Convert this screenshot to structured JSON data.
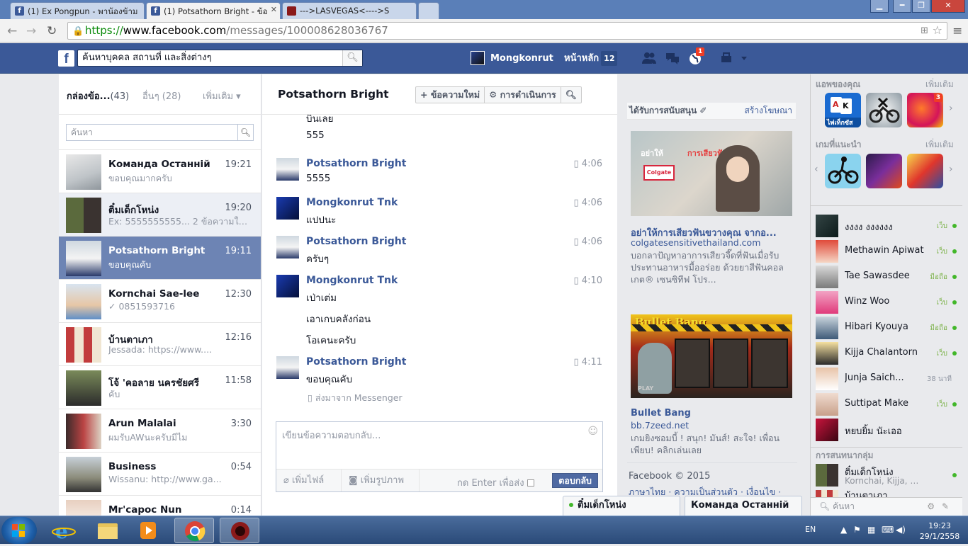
{
  "browser": {
    "tabs": [
      {
        "title": "(1) Ex Pongpun - พาน้องข้าม",
        "favicon": "f",
        "active": false
      },
      {
        "title": "(1) Potsathorn Bright - ข้อ",
        "favicon": "f",
        "active": true
      },
      {
        "title": "--->LASVEGAS<---->S",
        "favicon": "lasvegas-icon",
        "active": false
      }
    ],
    "url_scheme": "https://",
    "url_host": "www.facebook.com",
    "url_path": "/messages/100008628036767"
  },
  "topbar": {
    "logo": "f",
    "search_placeholder": "ค้นหาบุคคล สถานที่ และสิ่งต่างๆ",
    "user_name": "Mongkonrut",
    "home_label": "หน้าหลัก",
    "home_count": "12",
    "notif_count": "1"
  },
  "inbox": {
    "label": "กล่องข้อ...",
    "count": "(43)",
    "other_label": "อื่นๆ (28)",
    "more_label": "เพิ่มเติม ▾",
    "search_placeholder": "ค้นหา",
    "threads": [
      {
        "name": "Команда Останній",
        "time": "19:21",
        "snippet": "ขอบคุณมากครับ",
        "state": "normal"
      },
      {
        "name": "ติ๋มเด็กโหน่ง",
        "time": "19:20",
        "snippet": "Ex: 5555555555...   2 ข้อความใหม่",
        "state": "unread"
      },
      {
        "name": "Potsathorn Bright",
        "time": "19:11",
        "snippet": "ขอบคุณคับ",
        "state": "selected"
      },
      {
        "name": "Kornchai Sae-lee",
        "time": "12:30",
        "snippet": "✓ 0851593716",
        "state": "normal"
      },
      {
        "name": "บ้านตาเภา",
        "time": "12:16",
        "snippet": "Jessada: https://www....",
        "state": "normal"
      },
      {
        "name": "โจ้ 'คอลาย นครชัยศรี",
        "time": "11:58",
        "snippet": "คับ",
        "state": "normal"
      },
      {
        "name": "Arun Malalai",
        "time": "3:30",
        "snippet": "ผมรับAWนะครับมีไม",
        "state": "normal"
      },
      {
        "name": "Business",
        "time": "0:54",
        "snippet": "Wissanu: http://www.ga...",
        "state": "normal"
      },
      {
        "name": "Mr'capoc Nun",
        "time": "0:14",
        "snippet": "",
        "state": "normal"
      }
    ]
  },
  "conversation": {
    "title": "Potsathorn Bright",
    "new_message_label": "+ ข้อความใหม่",
    "actions_label": "⚙ การดำเนินการ",
    "messages": [
      {
        "sender": "",
        "time": "",
        "lines": [
          "บินเลย",
          "555"
        ]
      },
      {
        "sender": "Potsathorn Bright",
        "time": "4:06",
        "lines": [
          "5555"
        ]
      },
      {
        "sender": "Mongkonrut Tnk",
        "time": "4:06",
        "lines": [
          "แปปนะ"
        ]
      },
      {
        "sender": "Potsathorn Bright",
        "time": "4:06",
        "lines": [
          "ครับๆ"
        ]
      },
      {
        "sender": "Mongkonrut Tnk",
        "time": "4:10",
        "lines": [
          "เป่าเต่ม",
          "เอาเกบคลังก่อน",
          "โอเคนะครับ"
        ]
      },
      {
        "sender": "Potsathorn Bright",
        "time": "4:11",
        "lines": [
          "ขอบคุณคับ"
        ]
      }
    ],
    "sent_via": "ส่งมาจาก Messenger",
    "reply_placeholder": "เขียนข้อความตอบกลับ...",
    "attach_label": "เพิ่มไฟล์",
    "photo_label": "เพิ่มรูปภาพ",
    "enter_label": "กด Enter เพื่อส่ง",
    "send_label": "ตอบกลับ"
  },
  "ads": {
    "header": "ได้รับการสนับสนุน",
    "create_label": "สร้างโฆษณา",
    "ad1": {
      "img_text1": "อย่าให้",
      "img_text2": "การเสียวฟัน",
      "img_box": "Colgate",
      "title": "อย่าให้การเสียวฟันขวางคุณ จากอ...",
      "url": "colgatesensitivethailand.com",
      "desc": "บอกลาปัญหาอาการเสียวจี๊ดที่ฟันเมื่อรับประทานอาหารมื้ออร่อย ด้วยยาสีฟันคอลเกต® เซนซิทีฟ โปร..."
    },
    "ad2": {
      "img_logo": "Bullet Bang",
      "img_play": "PLAY",
      "title": "Bullet Bang",
      "url": "bb.7zeed.net",
      "desc": "เกมยิงซอมบี้ ! สนุก! มันส์! สะใจ! เพื่อนเพียบ! คลิกเล่นเลย"
    },
    "footer": "Facebook © 2015",
    "footer_links": "ภาษาไทย · ความเป็นส่วนตัว · เงื่อนไข ·"
  },
  "sidebar": {
    "apps_label": "แอพของคุณ",
    "apps_more": "เพิ่มเติม",
    "app1_label": "ไพ่เท็กซัส",
    "app3_badge": "3",
    "games_label": "เกมที่แนะนำ",
    "games_more": "เพิ่มเติม",
    "friends": [
      {
        "name": "งงงง งงงงงง",
        "status": "เว็บ"
      },
      {
        "name": "Methawin Apiwat",
        "status": "เว็บ"
      },
      {
        "name": "Tae Sawasdee",
        "status": "มือถือ"
      },
      {
        "name": "Winz Woo",
        "status": "เว็บ"
      },
      {
        "name": "Hibari Kyouya",
        "status": "มือถือ"
      },
      {
        "name": "Kijja Chalantorn",
        "status": "เว็บ"
      },
      {
        "name": "Junja Saich...",
        "status": "38 นาที"
      },
      {
        "name": "Suttipat Make",
        "status": "เว็บ"
      },
      {
        "name": "หยบยิ้ม นัะเออ",
        "status": ""
      }
    ],
    "groups_label": "การสนทนากลุ่ม",
    "group1_name": "ติ๋มเด็กโหน่ง",
    "group1_members": "Kornchai, Kijja, Wiss...",
    "group2_name": "บ้านตาเภา",
    "search_placeholder": "ค้นหา"
  },
  "chat_tabs": [
    "ติ๋มเด็กโหน่ง",
    "Команда Останній"
  ],
  "taskbar": {
    "lang": "EN",
    "time": "19:23",
    "date": "29/1/2558"
  }
}
